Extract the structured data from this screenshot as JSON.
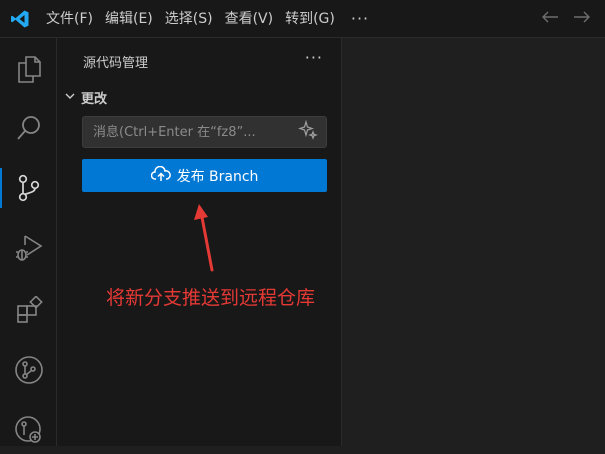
{
  "window": {
    "menu": [
      "文件(F)",
      "编辑(E)",
      "选择(S)",
      "查看(V)",
      "转到(G)"
    ],
    "more_menu": "···"
  },
  "icons": {
    "app_logo": "vscode-logo-icon",
    "nav_back": "arrow-left-icon",
    "nav_forward": "arrow-right-icon",
    "activity": [
      "explorer-icon",
      "search-icon",
      "source-control-icon",
      "run-debug-icon",
      "extensions-icon",
      "git-graph-icon",
      "remote-icon"
    ]
  },
  "sidebar": {
    "title": "源代码管理",
    "more": "···",
    "section_label": "更改",
    "commit_placeholder": "消息(Ctrl+Enter 在“fz8”...",
    "publish_label": "发布 Branch"
  },
  "annotation": {
    "text": "将新分支推送到远程仓库"
  },
  "colors": {
    "accent": "#0078d4",
    "annotation": "#e53935",
    "vscode_blue": "#23a9f2"
  }
}
